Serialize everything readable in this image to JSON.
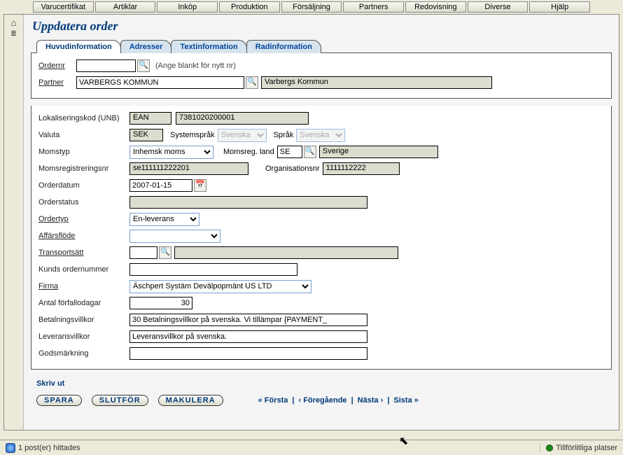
{
  "top_menu": [
    "Varucertifikat",
    "Artiklar",
    "Inköp",
    "Produktion",
    "Försäljning",
    "Partners",
    "Redovisning",
    "Diverse",
    "Hjälp"
  ],
  "page_title": "Uppdatera order",
  "tabs": [
    "Huvudinformation",
    "Adresser",
    "Textinformation",
    "Radinformation"
  ],
  "panel1": {
    "ordernr_label": "Ordernr",
    "ordernr_value": "",
    "ordernr_hint": "(Ange blankt för nytt nr)",
    "partner_label": "Partner",
    "partner_value": "VARBERGS KOMMUN",
    "partner_display": "Varbergs Kommun"
  },
  "panel2": {
    "unb_label": "Lokaliseringskod (UNB)",
    "unb_code": "EAN",
    "unb_value": "7381020200001",
    "valuta_label": "Valuta",
    "valuta_value": "SEK",
    "systemsprak_label": "Systemspråk",
    "systemsprak_value": "Svenska",
    "sprak_label": "Språk",
    "sprak_value": "Svenska",
    "momstyp_label": "Momstyp",
    "momstyp_value": "Inhemsk moms",
    "momsreg_label": "Momsreg. land",
    "momsreg_value": "SE",
    "momsreg_display": "Sverige",
    "momsregnr_label": "Momsregistreringsnr",
    "momsregnr_value": "se111111222201",
    "orgnr_label": "Organisationsnr",
    "orgnr_value": "1111112222",
    "orderdatum_label": "Orderdatum",
    "orderdatum_value": "2007-01-15",
    "orderstatus_label": "Orderstatus",
    "orderstatus_value": "",
    "ordertyp_label": "Ordertyp",
    "ordertyp_value": "En-leverans",
    "affarsflode_label": "Affärsflöde",
    "affarsflode_value": "",
    "transportsatt_label": "Transportsätt",
    "transportsatt_value": "",
    "transportsatt_display": "",
    "kundorder_label": "Kunds ordernummer",
    "kundorder_value": "",
    "firma_label": "Firma",
    "firma_value": "Äschpert Systäm Devälpopmänt US LTD",
    "forfall_label": "Antal förfallodagar",
    "forfall_value": "30",
    "betvillkor_label": "Betalningsvillkor",
    "betvillkor_value": "30 Betalningsvillkor på svenska. Vi tillämpar {PAYMENT_",
    "levvillkor_label": "Leveransvillkor",
    "levvillkor_value": "Leveransvillkor på svenska.",
    "godsmark_label": "Godsmärkning",
    "godsmark_value": ""
  },
  "footer": {
    "print": "Skriv ut",
    "save": "SPARA",
    "finish": "SLUTFÖR",
    "cancel": "MAKULERA",
    "first": "« Första",
    "prev": "‹ Föregående",
    "next": "Nästa ›",
    "last": "Sista »"
  },
  "status": {
    "left": "1 post(er) hittades",
    "right": "Tillförlitliga platser"
  }
}
